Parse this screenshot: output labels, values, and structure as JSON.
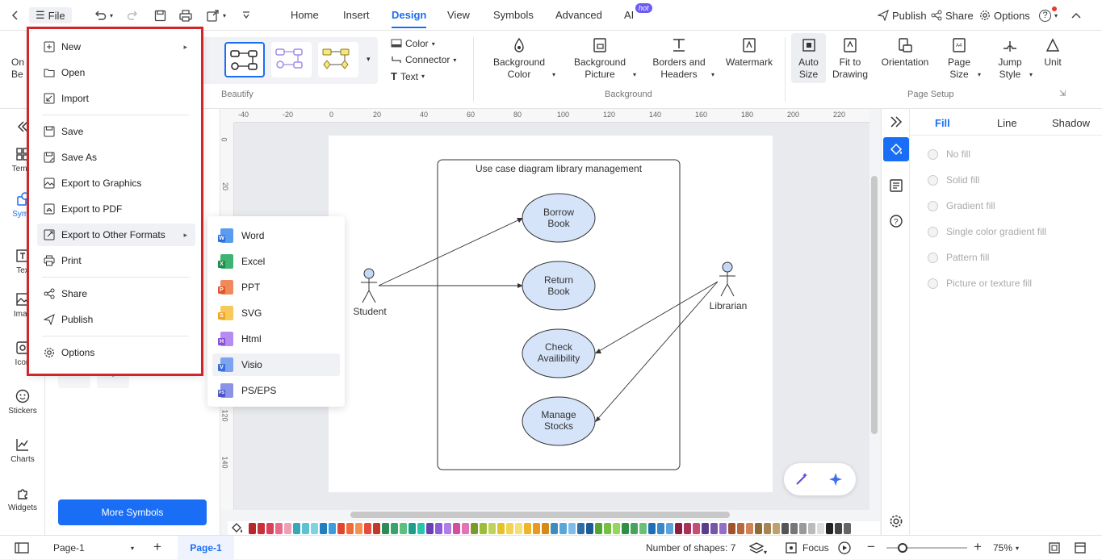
{
  "topbar": {
    "file_label": "File",
    "tabs": [
      "Home",
      "Insert",
      "Design",
      "View",
      "Symbols",
      "Advanced",
      "AI"
    ],
    "active_tab": "Design",
    "ai_badge": "hot",
    "publish": "Publish",
    "share": "Share",
    "options": "Options",
    "help": "?"
  },
  "ribbon": {
    "left_partial": [
      "On",
      "Be"
    ],
    "color": "Color",
    "connector": "Connector",
    "text": "Text",
    "beautify_label": "Beautify",
    "bg_color": [
      "Background",
      "Color"
    ],
    "bg_picture": [
      "Background",
      "Picture"
    ],
    "borders": [
      "Borders and",
      "Headers"
    ],
    "watermark": "Watermark",
    "background_label": "Background",
    "auto_size": [
      "Auto",
      "Size"
    ],
    "fit_drawing": [
      "Fit to",
      "Drawing"
    ],
    "orientation": "Orientation",
    "page_size": [
      "Page",
      "Size"
    ],
    "jump_style": [
      "Jump",
      "Style"
    ],
    "unit": "Unit",
    "page_setup_label": "Page Setup"
  },
  "left_tools": [
    "Templ",
    "Symb",
    "Tex",
    "Imag",
    "Icon",
    "Stickers",
    "Charts",
    "Widgets"
  ],
  "left_panel": {
    "more_symbols": "More Symbols"
  },
  "file_menu": {
    "items": [
      {
        "label": "New",
        "icon": "plus-square-icon",
        "submenu": true
      },
      {
        "label": "Open",
        "icon": "folder-icon"
      },
      {
        "label": "Import",
        "icon": "import-icon"
      },
      {
        "label": "Save",
        "icon": "save-icon"
      },
      {
        "label": "Save As",
        "icon": "save-as-icon"
      },
      {
        "label": "Export to Graphics",
        "icon": "image-icon"
      },
      {
        "label": "Export to PDF",
        "icon": "pdf-icon"
      },
      {
        "label": "Export to Other Formats",
        "icon": "export-icon",
        "submenu": true
      },
      {
        "label": "Print",
        "icon": "printer-icon"
      },
      {
        "label": "Share",
        "icon": "share-icon"
      },
      {
        "label": "Publish",
        "icon": "publish-icon"
      },
      {
        "label": "Options",
        "icon": "gear-icon"
      }
    ]
  },
  "export_submenu": [
    {
      "label": "Word",
      "color": "#2b6fdb",
      "letter": "W"
    },
    {
      "label": "Excel",
      "color": "#1e8a4c",
      "letter": "X"
    },
    {
      "label": "PPT",
      "color": "#e0582b",
      "letter": "P"
    },
    {
      "label": "SVG",
      "color": "#f0a623",
      "letter": "S"
    },
    {
      "label": "Html",
      "color": "#8a4fd8",
      "letter": "H"
    },
    {
      "label": "Visio",
      "color": "#3b6fd6",
      "letter": "V"
    },
    {
      "label": "PS/EPS",
      "color": "#4b57c9",
      "letter": "PS"
    }
  ],
  "ruler": {
    "h": [
      "-40",
      "-20",
      "0",
      "20",
      "40",
      "60",
      "80",
      "100",
      "120",
      "140",
      "160",
      "180",
      "200",
      "220"
    ],
    "v": [
      "0",
      "20",
      "120",
      "140"
    ]
  },
  "diagram": {
    "title": "Use case diagram library management",
    "actors": [
      "Student",
      "Librarian"
    ],
    "use_cases": [
      [
        "Borrow",
        "Book"
      ],
      [
        "Return",
        "Book"
      ],
      [
        "Check",
        "Availibility"
      ],
      [
        "Manage",
        "Stocks"
      ]
    ]
  },
  "right_panel": {
    "tabs": [
      "Fill",
      "Line",
      "Shadow"
    ],
    "active_tab": "Fill",
    "fill_options": [
      "No fill",
      "Solid fill",
      "Gradient fill",
      "Single color gradient fill",
      "Pattern fill",
      "Picture or texture fill"
    ]
  },
  "status": {
    "page_selector": "Page-1",
    "page_tab": "Page-1",
    "shapes": "Number of shapes: 7",
    "focus": "Focus",
    "zoom": "75%"
  },
  "palette": [
    "#b5282e",
    "#c8313a",
    "#d9415a",
    "#e86b8a",
    "#efa0b6",
    "#3aa6b9",
    "#5cc1d0",
    "#7fd3df",
    "#1f7fbf",
    "#3d9be0",
    "#e0452d",
    "#ef6b3a",
    "#f39252",
    "#e84c3d",
    "#c0392b",
    "#2e8b57",
    "#3aa36a",
    "#5cbf80",
    "#1b9e8c",
    "#27c4ae",
    "#6a3fb5",
    "#8e5cd6",
    "#b07ee6",
    "#d04fa0",
    "#e373b9",
    "#7a9a2a",
    "#9bbd3a",
    "#bed35a",
    "#e6c229",
    "#f2d452",
    "#f4e07a",
    "#f0b429",
    "#e69b1e",
    "#d68a14",
    "#3c8dbc",
    "#5aa6d6",
    "#7fbde8",
    "#2c6da8",
    "#1d5a94",
    "#55a630",
    "#73c043",
    "#97d65e",
    "#2f8f46",
    "#4aa35c",
    "#6bbf7a",
    "#1e6fb8",
    "#3a88cc",
    "#5ea2dc",
    "#8b1e3f",
    "#a8325a",
    "#c44f76",
    "#5a3e8c",
    "#7656a8",
    "#926fc4",
    "#a0522d",
    "#b8683f",
    "#d08356",
    "#8c6d3a",
    "#a68652",
    "#c0a06c",
    "#555555",
    "#777777",
    "#999999",
    "#bbbbbb",
    "#dddddd",
    "#222222",
    "#444444",
    "#666666"
  ]
}
